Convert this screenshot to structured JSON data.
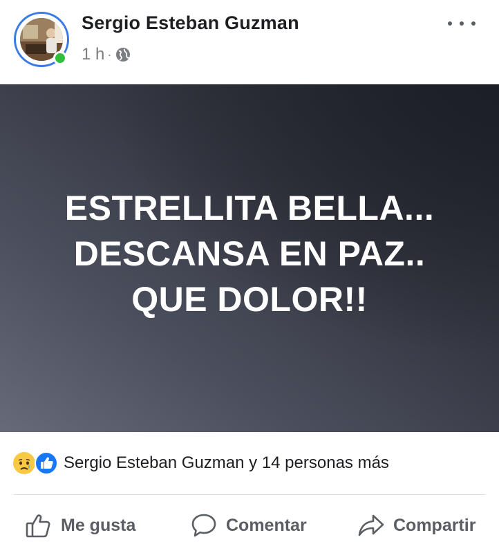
{
  "post": {
    "author": "Sergio Esteban Guzman",
    "time": "1 h",
    "separator": "·",
    "privacy_icon": "globe-icon",
    "more_icon": "more-dots-icon",
    "online": true,
    "content": {
      "lines": [
        "ESTRELLITA BELLA...",
        "DESCANSA EN PAZ..",
        "QUE DOLOR!!"
      ],
      "background_colors": [
        "#666a79",
        "#23262d"
      ]
    }
  },
  "reactions": {
    "icons": [
      "sad-reaction-icon",
      "like-reaction-icon"
    ],
    "summary": "Sergio Esteban Guzman y 14 personas más"
  },
  "actions": {
    "like_label": "Me gusta",
    "comment_label": "Comentar",
    "share_label": "Compartir"
  },
  "colors": {
    "online": "#2fbf3a",
    "ring": "#3b7be6",
    "like_blue": "#1877f2",
    "sad_yellow": "#f7c944"
  }
}
